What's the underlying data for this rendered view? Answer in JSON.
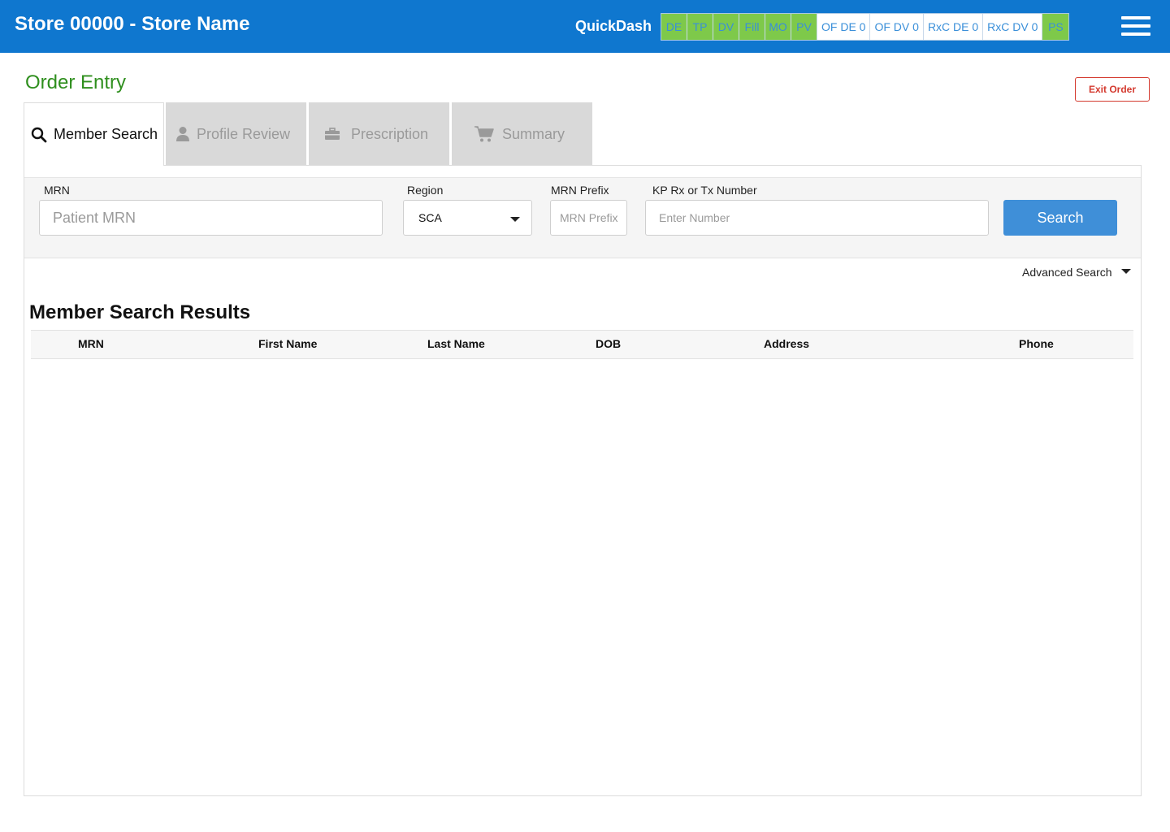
{
  "header": {
    "store_title": "Store 00000 - Store Name",
    "quickdash_label": "QuickDash",
    "quickdash_items": [
      {
        "label": "DE",
        "style": "green"
      },
      {
        "label": "TP",
        "style": "green"
      },
      {
        "label": "DV",
        "style": "green"
      },
      {
        "label": "Fill",
        "style": "green"
      },
      {
        "label": "MO",
        "style": "green"
      },
      {
        "label": "PV",
        "style": "green"
      },
      {
        "label": "OF DE 0",
        "style": "white"
      },
      {
        "label": "OF DV 0",
        "style": "white"
      },
      {
        "label": "RxC DE 0",
        "style": "white"
      },
      {
        "label": "RxC DV 0",
        "style": "white"
      },
      {
        "label": "PS",
        "style": "green"
      }
    ],
    "menu_icon": "hamburger-menu-icon",
    "colors": {
      "bar": "#0f77cf",
      "badge_green": "#7ec94a",
      "badge_text": "#3a8fd9"
    }
  },
  "page": {
    "title": "Order Entry",
    "exit_label": "Exit Order"
  },
  "tabs": [
    {
      "label": "Member Search",
      "icon": "search-icon",
      "active": true
    },
    {
      "label": "Profile Review",
      "icon": "person-icon",
      "active": false
    },
    {
      "label": "Prescription",
      "icon": "briefcase-icon",
      "active": false
    },
    {
      "label": "Summary",
      "icon": "cart-icon",
      "active": false
    }
  ],
  "search": {
    "mrn_label": "MRN",
    "mrn_placeholder": "Patient MRN",
    "region_label": "Region",
    "region_value": "SCA",
    "prefix_label": "MRN Prefix",
    "prefix_placeholder": "MRN Prefix",
    "number_label": "KP Rx or Tx Number",
    "number_placeholder": "Enter Number",
    "button_label": "Search",
    "advanced_label": "Advanced Search"
  },
  "results": {
    "title": "Member Search Results",
    "columns": [
      "MRN",
      "First Name",
      "Last Name",
      "DOB",
      "Address",
      "Phone"
    ],
    "rows": []
  }
}
